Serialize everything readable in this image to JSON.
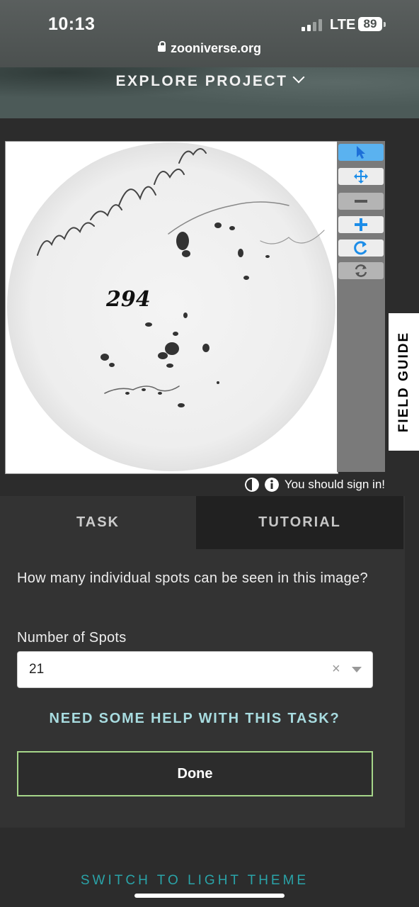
{
  "status_bar": {
    "time": "10:13",
    "network": "LTE",
    "battery": "89",
    "url": "zooniverse.org"
  },
  "header": {
    "title": "EXPLORE PROJECT"
  },
  "subject": {
    "sketch_number": "294",
    "handwriting": "Nuo mo fr"
  },
  "toolbar": {
    "tools": [
      "annotate",
      "move",
      "zoom-out",
      "zoom-in",
      "rotate",
      "reset"
    ],
    "active": "annotate"
  },
  "field_guide": "FIELD GUIDE",
  "meta_bar": {
    "sign_in_text": "You should sign in!"
  },
  "tabs": {
    "task": "TASK",
    "tutorial": "TUTORIAL",
    "selected": "TASK"
  },
  "task": {
    "question": "How many individual spots can be seen in this image?",
    "field_label": "Number of Spots",
    "selected_value": "21",
    "help_link": "NEED SOME HELP WITH THIS TASK?",
    "done_label": "Done"
  },
  "footer": {
    "theme_switch": "SWITCH TO LIGHT THEME"
  },
  "colors": {
    "accent_blue": "#1d8de8",
    "help_text": "#a8dce0",
    "done_border": "#a6d68a",
    "theme_link": "#2aa3a8"
  }
}
